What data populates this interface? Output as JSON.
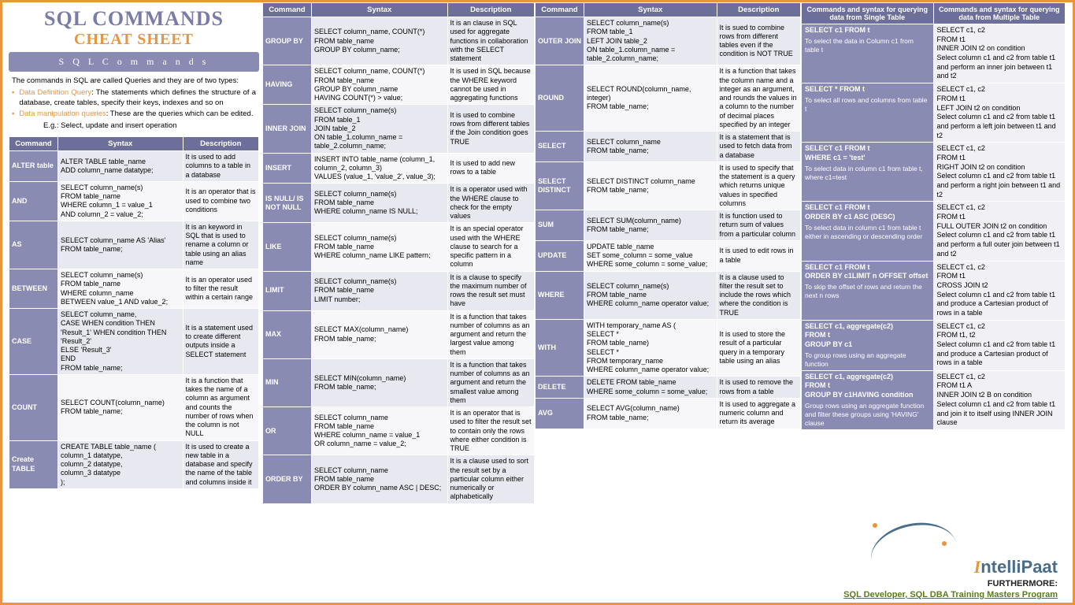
{
  "title1": "SQL COMMANDS",
  "title2": "CHEAT SHEET",
  "band": "S Q L   C o m m a n d s",
  "intro_lead": "The commands in SQL are called Queries and they are of two types:",
  "intro_b1_label": "Data Definition Query",
  "intro_b1_text": ": The statements which defines the structure of a database, create tables, specify their keys, indexes and so on",
  "intro_b2_label": "Data manipulation queries",
  "intro_b2_text": ": These are the queries which can be edited.",
  "intro_eg": "E.g.: Select, update and insert operation",
  "hdr_cmd": "Command",
  "hdr_syn": "Syntax",
  "hdr_desc": "Description",
  "t0": [
    {
      "c": "ALTER table",
      "s": "ALTER TABLE table_name\nADD column_name datatype;",
      "d": "It is used to add columns to a table in a database"
    },
    {
      "c": "AND",
      "s": "SELECT column_name(s)\nFROM table_name\nWHERE column_1 = value_1\nAND column_2 = value_2;",
      "d": "It is an operator that is used to combine two conditions"
    },
    {
      "c": "AS",
      "s": "SELECT column_name AS 'Alias'\nFROM table_name;",
      "d": "It is an keyword in SQL that is used to rename a column or table using an alias name"
    },
    {
      "c": "BETWEEN",
      "s": "SELECT column_name(s)\nFROM table_name\nWHERE column_name\nBETWEEN value_1 AND value_2;",
      "d": "It is an operator used to filter the result within a certain range"
    },
    {
      "c": "CASE",
      "s": "SELECT column_name,\nCASE   WHEN condition THEN 'Result_1'   WHEN condition THEN 'Result_2'\nELSE 'Result_3'\nEND\nFROM table_name;",
      "d": "It is a statement used to create different outputs inside a SELECT statement"
    },
    {
      "c": "COUNT",
      "s": "SELECT COUNT(column_name)\nFROM table_name;",
      "d": "It is a function that takes the name of a column as argument and counts the number of rows when the column is not NULL"
    },
    {
      "c": "Create TABLE",
      "s": "CREATE TABLE table_name (\ncolumn_1 datatype,\ncolumn_2 datatype,\ncolumn_3 datatype\n);",
      "d": "It is used to create a new table in a database and specify the name of the table and columns inside it"
    }
  ],
  "t1": [
    {
      "c": "GROUP BY",
      "s": "SELECT column_name, COUNT(*)\nFROM table_name\nGROUP BY column_name;",
      "d": "It is an clause in SQL used for aggregate functions in collaboration with the SELECT statement"
    },
    {
      "c": "HAVING",
      "s": "SELECT column_name, COUNT(*)\nFROM table_name\nGROUP BY column_name\nHAVING COUNT(*) > value;",
      "d": "It is used in SQL because the WHERE keyword cannot be used in aggregating functions"
    },
    {
      "c": "INNER JOIN",
      "s": "SELECT column_name(s)\nFROM table_1\nJOIN table_2\nON table_1.column_name = table_2.column_name;",
      "d": "It is used to combine rows from different tables if the Join condition goes TRUE"
    },
    {
      "c": "INSERT",
      "s": "INSERT INTO table_name (column_1, column_2, column_3)\nVALUES (value_1, 'value_2', value_3);",
      "d": "It is used to add new rows to a table"
    },
    {
      "c": "IS NULL/ IS NOT NULL",
      "s": "SELECT column_name(s)\nFROM table_name\nWHERE column_name IS NULL;",
      "d": "It is a operator used with the WHERE clause to check for the empty values"
    },
    {
      "c": "LIKE",
      "s": "SELECT column_name(s)\nFROM table_name\nWHERE column_name LIKE pattern;",
      "d": "It is an special operator used with the WHERE clause to search for a specific pattern in a column"
    },
    {
      "c": "LIMIT",
      "s": "SELECT column_name(s)\nFROM table_name\nLIMIT number;",
      "d": "It is a clause to specify the maximum number of rows the result set must have"
    },
    {
      "c": "MAX",
      "s": "SELECT MAX(column_name)\nFROM table_name;",
      "d": "It is a function that takes number of columns as an argument and return the largest value among them"
    },
    {
      "c": "MIN",
      "s": "SELECT MIN(column_name)\nFROM table_name;",
      "d": "It is a function that takes number of columns as an argument and return the smallest value among them"
    },
    {
      "c": "OR",
      "s": "SELECT column_name\nFROM table_name\nWHERE column_name = value_1\nOR column_name = value_2;",
      "d": "It is an operator that is used to filter the result set to contain only the rows where either condition is TRUE"
    },
    {
      "c": "ORDER BY",
      "s": "SELECT column_name\nFROM table_name\nORDER BY column_name ASC | DESC;",
      "d": "It is a clause used to sort the result set by a particular column either numerically or alphabetically"
    }
  ],
  "t2": [
    {
      "c": "OUTER JOIN",
      "s": "SELECT column_name(s)\nFROM table_1\nLEFT JOIN table_2\nON table_1.column_name = table_2.column_name;",
      "d": "It is sued to combine rows from different tables even if the condition is NOT TRUE"
    },
    {
      "c": "ROUND",
      "s": "SELECT ROUND(column_name, integer)\nFROM table_name;",
      "d": "It is a function that takes the column name and a integer as an argument, and rounds the values in a column to the number of decimal places specified by an integer"
    },
    {
      "c": "SELECT",
      "s": "SELECT column_name\nFROM table_name;",
      "d": "It is a statement that is used to fetch data from a database"
    },
    {
      "c": "SELECT DISTINCT",
      "s": "SELECT DISTINCT column_name\nFROM table_name;",
      "d": "It is used to specify that the statement is a query which returns unique values in specified columns"
    },
    {
      "c": "SUM",
      "s": "SELECT SUM(column_name)\nFROM table_name;",
      "d": "It is function used to return sum of values from a particular column"
    },
    {
      "c": "UPDATE",
      "s": "UPDATE table_name\nSET some_column = some_value\nWHERE some_column = some_value;",
      "d": "It is used to edit rows in a table"
    },
    {
      "c": "WHERE",
      "s": "SELECT column_name(s)\nFROM table_name\nWHERE column_name operator value;",
      "d": "It is a clause used to filter the result set to include the rows which where the condition is TRUE"
    },
    {
      "c": "WITH",
      "s": "WITH temporary_name AS (\nSELECT *\nFROM table_name)\nSELECT *\nFROM temporary_name\nWHERE column_name operator value;",
      "d": "It is used to store the result of a particular query in a temporary table using an alias"
    },
    {
      "c": "DELETE",
      "s": "DELETE FROM table_name\nWHERE some_column = some_value;",
      "d": "It is used to remove the rows from a table"
    },
    {
      "c": "AVG",
      "s": "SELECT AVG(column_name)\nFROM table_name;",
      "d": "It is used to aggregate a numeric column and return its average"
    }
  ],
  "ref_h1": "Commands and syntax for querying data from Single Table",
  "ref_h2": "Commands and syntax for querying data from Multiple Table",
  "ref": [
    {
      "l": "SELECT c1 FROM t",
      "ls": "To select the data in Column c1 from table t",
      "r": "SELECT c1, c2\nFROM t1\nINNER JOIN t2 on condition\nSelect column c1 and c2 from table t1 and perform an inner join between t1 and t2"
    },
    {
      "l": "SELECT * FROM t",
      "ls": "To select all rows and columns from table t",
      "r": "SELECT c1, c2\nFROM t1\nLEFT JOIN t2 on condition\nSelect column c1 and c2 from table t1 and perform a left join between t1 and t2"
    },
    {
      "l": "SELECT c1 FROM t\nWHERE c1 = 'test'",
      "ls": "To select data in column c1 from table t, where c1=test",
      "r": "SELECT c1, c2\nFROM t1\nRIGHT JOIN t2 on condition\nSelect column c1 and c2 from table t1 and perform a right join between t1 and t2"
    },
    {
      "l": "SELECT c1 FROM t\nORDER BY c1 ASC (DESC)",
      "ls": "To select data in column c1 from table t either in ascending or descending order",
      "r": "SELECT c1, c2\nFROM t1\nFULL OUTER JOIN t2 on condition\nSelect column c1 and c2 from table t1 and perform a full outer join between t1 and t2"
    },
    {
      "l": "SELECT c1 FROM t\nORDER BY c1LIMIT n OFFSET offset",
      "ls": "To skip the offset of rows and return the next n rows",
      "r": "SELECT c1, c2\nFROM t1\nCROSS JOIN t2\nSelect column c1 and c2 from table t1 and produce a Cartesian product of rows in a table"
    },
    {
      "l": "SELECT c1, aggregate(c2)\nFROM t\nGROUP BY c1",
      "ls": "To group rows using an aggregate function",
      "r": "SELECT c1, c2\nFROM t1, t2\nSelect column c1 and c2 from table t1 and produce a Cartesian product of rows in a table"
    },
    {
      "l": "SELECT c1, aggregate(c2)\nFROM t\nGROUP BY c1HAVING condition",
      "ls": "Group rows using an aggregate function and filter these groups using 'HAVING' clause",
      "r": "SELECT c1, c2\nFROM t1 A\nINNER JOIN t2 B on condition\nSelect column c1 and c2 from table t1 and join it to itself using INNER JOIN clause"
    }
  ],
  "logo_i": "I",
  "logo_rest": "ntelliPaat",
  "further": "FURTHERMORE:",
  "link": "SQL Developer, SQL DBA Training Masters Program"
}
